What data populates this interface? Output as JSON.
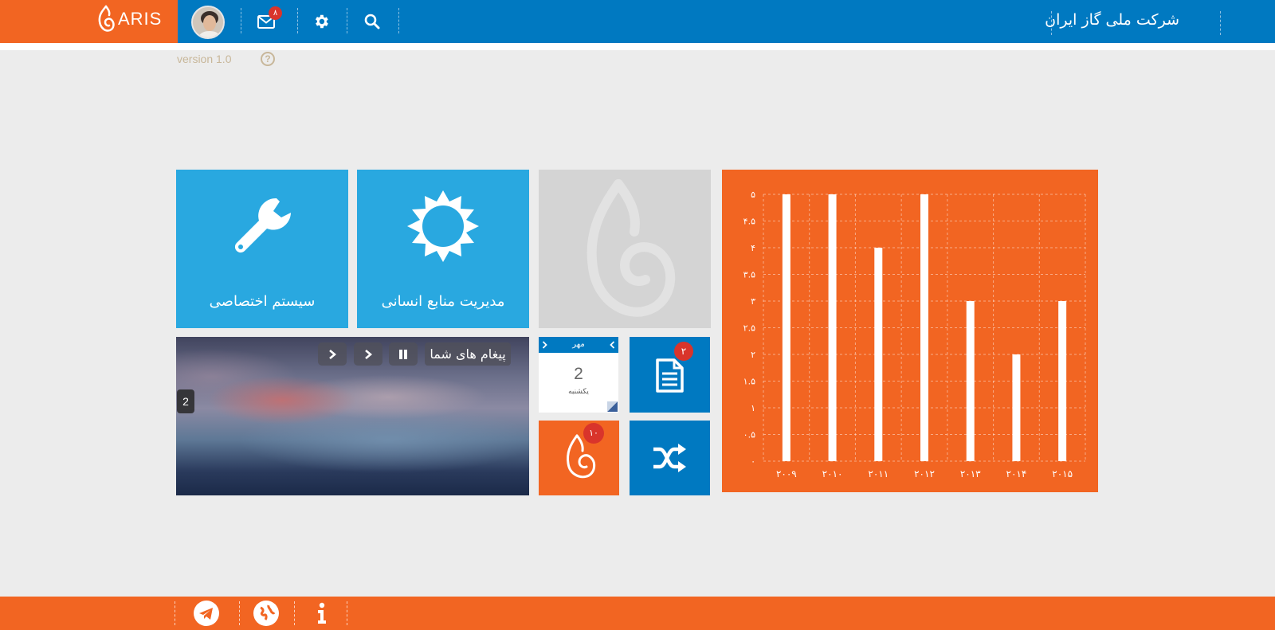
{
  "header": {
    "logo_text": "ARIS",
    "company_name": "شرکت ملی گاز ایران",
    "mail_badge": "۸"
  },
  "meta": {
    "version": "version 1.0",
    "help_glyph": "?"
  },
  "tiles": {
    "custom_system": "سیستم اختصاصی",
    "hr_management": "مدیریت منابع انسانی"
  },
  "slider": {
    "title": "پیغام های شما",
    "counter": "2"
  },
  "calendar": {
    "month": "مهر",
    "day": "2",
    "weekday": "یکشنبه"
  },
  "small_tiles": {
    "documents_badge": "۲",
    "flame_badge": "۱۰"
  },
  "colors": {
    "primary_blue": "#0079c1",
    "light_blue": "#29a8e0",
    "orange": "#f26522",
    "badge_red": "#d9342b"
  },
  "chart_data": {
    "type": "bar",
    "categories": [
      "۲۰۰۹",
      "۲۰۱۰",
      "۲۰۱۱",
      "۲۰۱۲",
      "۲۰۱۳",
      "۲۰۱۴",
      "۲۰۱۵"
    ],
    "values": [
      5,
      5,
      4,
      5,
      3,
      2,
      3
    ],
    "y_ticks": [
      "۰",
      "۰.۵",
      "۱",
      "۱.۵",
      "۲",
      "۲.۵",
      "۳",
      "۳.۵",
      "۴",
      "۴.۵",
      "۵"
    ],
    "ylim": [
      0,
      5
    ],
    "grid": true
  }
}
